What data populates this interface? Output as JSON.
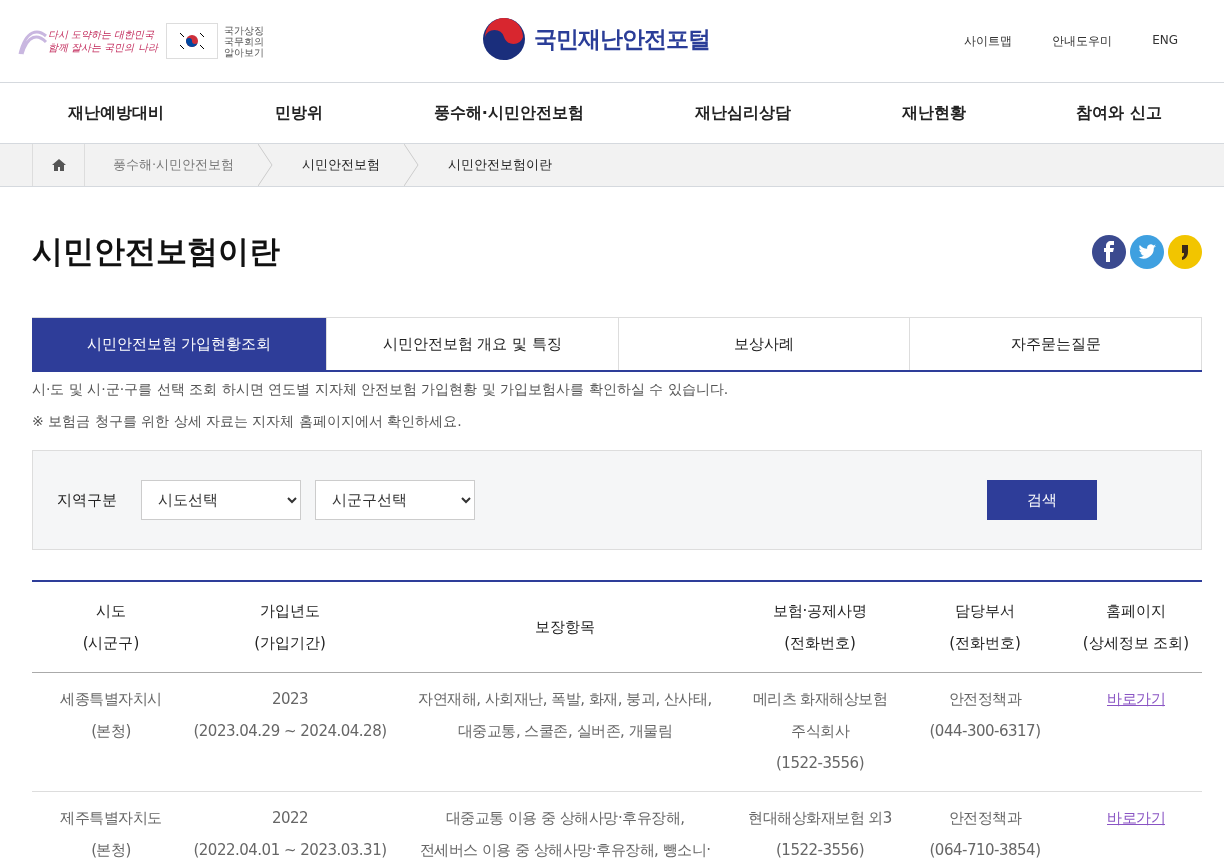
{
  "header": {
    "slogan": [
      "다시 도약하는 대한민국",
      "함께 잘사는 국민의 나라"
    ],
    "symbol_link": [
      "국가상징",
      "국무회의",
      "알아보기"
    ],
    "logo": "국민재난안전포털",
    "util_links": [
      "사이트맵",
      "안내도우미",
      "ENG"
    ]
  },
  "nav": [
    "재난예방대비",
    "민방위",
    "풍수해·시민안전보험",
    "재난심리상담",
    "재난현황",
    "참여와 신고"
  ],
  "breadcrumb": [
    {
      "label": "풍수해·시민안전보험",
      "current": false
    },
    {
      "label": "시민안전보험",
      "current": true
    },
    {
      "label": "시민안전보험이란",
      "current": true
    }
  ],
  "page_title": "시민안전보험이란",
  "tabs": [
    {
      "label": "시민안전보험 가입현황조회",
      "selected": true
    },
    {
      "label": "시민안전보험 개요 및 특징",
      "selected": false
    },
    {
      "label": "보상사례",
      "selected": false
    },
    {
      "label": "자주묻는질문",
      "selected": false
    }
  ],
  "notes": [
    "시·도 및 시·군·구를 선택 조회 하시면 연도별 지자체 안전보험 가입현황 및 가입보험사를 확인하실 수 있습니다.",
    "※ 보험금 청구를 위한 상세 자료는 지자체 홈페이지에서 확인하세요."
  ],
  "search": {
    "label": "지역구분",
    "selects": [
      "시도선택",
      "시군구선택"
    ],
    "button": "검색"
  },
  "table": {
    "columns": [
      {
        "title": "시도",
        "subtitle": "(시군구)"
      },
      {
        "title": "가입년도",
        "subtitle": "(가입기간)"
      },
      {
        "title": "보장항목"
      },
      {
        "title": "보험·공제사명",
        "subtitle": "(전화번호)"
      },
      {
        "title": "담당부서",
        "subtitle": "(전화번호)"
      },
      {
        "title": "홈페이지",
        "subtitle": "(상세정보 조회)"
      }
    ],
    "rows": [
      {
        "cells": [
          [
            "세종특별자치시",
            "(본청)"
          ],
          [
            "2023",
            "(2023.04.29 ~ 2024.04.28)"
          ],
          [
            "자연재해, 사회재난, 폭발, 화재, 붕괴, 산사태,",
            "대중교통, 스쿨존, 실버존, 개물림"
          ],
          [
            "메리츠 화재해상보험",
            "주식회사",
            "(1522-3556)"
          ],
          [
            "안전정책과",
            "(044-300-6317)"
          ]
        ],
        "link": "바로가기"
      },
      {
        "cells": [
          [
            "제주특별자치도",
            "(본청)"
          ],
          [
            "2022",
            "(2022.04.01 ~ 2023.03.31)"
          ],
          [
            "대중교통 이용 중 상해사망·후유장해,",
            "전세버스 이용 중 상해사망·후유장해, 뺑소니·"
          ],
          [
            "현대해상화재보험 외3",
            "(1522-3556)"
          ],
          [
            "안전정책과",
            "(064-710-3854)"
          ]
        ],
        "link": "바로가기"
      }
    ]
  }
}
